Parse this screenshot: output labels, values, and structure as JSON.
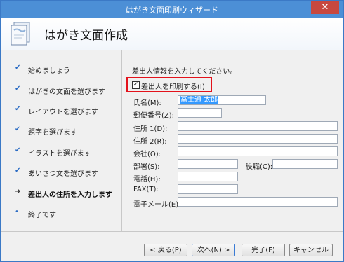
{
  "window": {
    "title": "はがき文面印刷ウィザード",
    "close_label": "✕"
  },
  "header": {
    "title": "はがき文面作成",
    "logo_icon": "postcard-document-icon"
  },
  "sidebar": {
    "steps": [
      {
        "label": "始めましょう",
        "mark": "✔",
        "state": "done"
      },
      {
        "label": "はがきの文面を選びます",
        "mark": "✔",
        "state": "done"
      },
      {
        "label": "レイアウトを選びます",
        "mark": "✔",
        "state": "done"
      },
      {
        "label": "題字を選びます",
        "mark": "✔",
        "state": "done"
      },
      {
        "label": "イラストを選びます",
        "mark": "✔",
        "state": "done"
      },
      {
        "label": "あいさつ文を選びます",
        "mark": "✔",
        "state": "done"
      },
      {
        "label": "差出人の住所を入力します",
        "mark": "➜",
        "state": "current"
      },
      {
        "label": "終了です",
        "mark": "•",
        "state": "pending"
      }
    ]
  },
  "main": {
    "intro": "差出人情報を入力してください。",
    "print_sender": {
      "label": "差出人を印刷する(I)",
      "checked": "✓"
    },
    "fields": {
      "name": {
        "label": "氏名(M):",
        "value": "富士通 太郎"
      },
      "zip": {
        "label": "郵便番号(Z):",
        "value": ""
      },
      "address1": {
        "label": "住所 1(D):",
        "value": ""
      },
      "address2": {
        "label": "住所 2(R):",
        "value": ""
      },
      "company": {
        "label": "会社(O):",
        "value": ""
      },
      "department": {
        "label": "部署(S):",
        "value": ""
      },
      "title": {
        "label": "役職(C):",
        "value": ""
      },
      "phone": {
        "label": "電話(H):",
        "value": ""
      },
      "fax": {
        "label": "FAX(T):",
        "value": ""
      },
      "email": {
        "label": "電子メール(E):",
        "value": ""
      }
    }
  },
  "buttons": {
    "back": "< 戻る(P)",
    "next": "次へ(N) >",
    "finish": "完了(F)",
    "cancel": "キャンセル"
  },
  "colors": {
    "titlebar": "#4c8fd6",
    "close": "#c7483f",
    "highlight_border": "#e3121b",
    "check_mark": "#2b6cc4"
  }
}
